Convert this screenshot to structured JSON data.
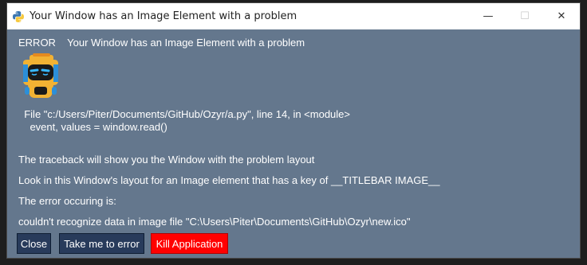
{
  "window": {
    "title": "Your Window has an Image Element with a problem",
    "controls": {
      "minimize": "—",
      "maximize": "☐",
      "close": "✕"
    }
  },
  "error": {
    "heading": "ERROR    Your Window has an Image Element with a problem",
    "traceback_line1": "  File \"c:/Users/Piter/Documents/GitHub/Ozyr/a.py\", line 14, in <module>",
    "traceback_line2": "    event, values = window.read()",
    "message1": "The traceback will show you the Window with the problem layout",
    "message2": "Look in this Window's layout for an Image element that has a key of __TITLEBAR IMAGE__",
    "message3": "The error occuring is:",
    "message4": "couldn't recognize data in image file \"C:\\Users\\Piter\\Documents\\GitHub\\Ozyr\\new.ico\""
  },
  "buttons": {
    "close": "Close",
    "take_me": "Take me to error",
    "kill": "Kill Application"
  },
  "icons": {
    "app": "python-logo-icon",
    "mascot": "robot-mascot-icon"
  },
  "colors": {
    "background": "#64778d",
    "button": "#283b5b",
    "kill_button": "#ff0000"
  }
}
